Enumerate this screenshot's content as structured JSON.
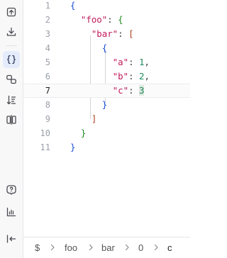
{
  "sidebar": {
    "buttons": [
      {
        "name": "import-icon"
      },
      {
        "name": "download-icon"
      },
      {
        "name": "braces-icon"
      },
      {
        "name": "transform-icon"
      },
      {
        "name": "sort-icon"
      },
      {
        "name": "compare-icon"
      },
      {
        "name": "help-icon"
      },
      {
        "name": "statistics-icon"
      },
      {
        "name": "collapse-sidebar-icon"
      }
    ]
  },
  "editor": {
    "line_numbers": [
      "1",
      "2",
      "3",
      "4",
      "5",
      "6",
      "7",
      "8",
      "9",
      "10",
      "11"
    ],
    "current_line": "7",
    "lines": [
      [
        "{"
      ],
      [
        "  ",
        "\"foo\"",
        ": ",
        "{"
      ],
      [
        "    ",
        "\"bar\"",
        ": ",
        "["
      ],
      [
        "      ",
        "{"
      ],
      [
        "        ",
        "\"a\"",
        ": ",
        "1",
        ","
      ],
      [
        "        ",
        "\"b\"",
        ": ",
        "2",
        ","
      ],
      [
        "        ",
        "\"c\"",
        ": ",
        "3"
      ],
      [
        "      ",
        "}"
      ],
      [
        "    ",
        "]"
      ],
      [
        "  ",
        "}"
      ],
      [
        "}"
      ]
    ]
  },
  "statusbar": {
    "path": [
      "$",
      "foo",
      "bar",
      "0",
      "c"
    ]
  },
  "colors": {
    "brace_level1": "#1e4fd8",
    "brace_level2": "#1f8a1f",
    "bracket_level3": "#a63f1a",
    "key": "#c2185b",
    "number": "#1f8a5b",
    "active_button_bg": "#e4ecfb"
  }
}
